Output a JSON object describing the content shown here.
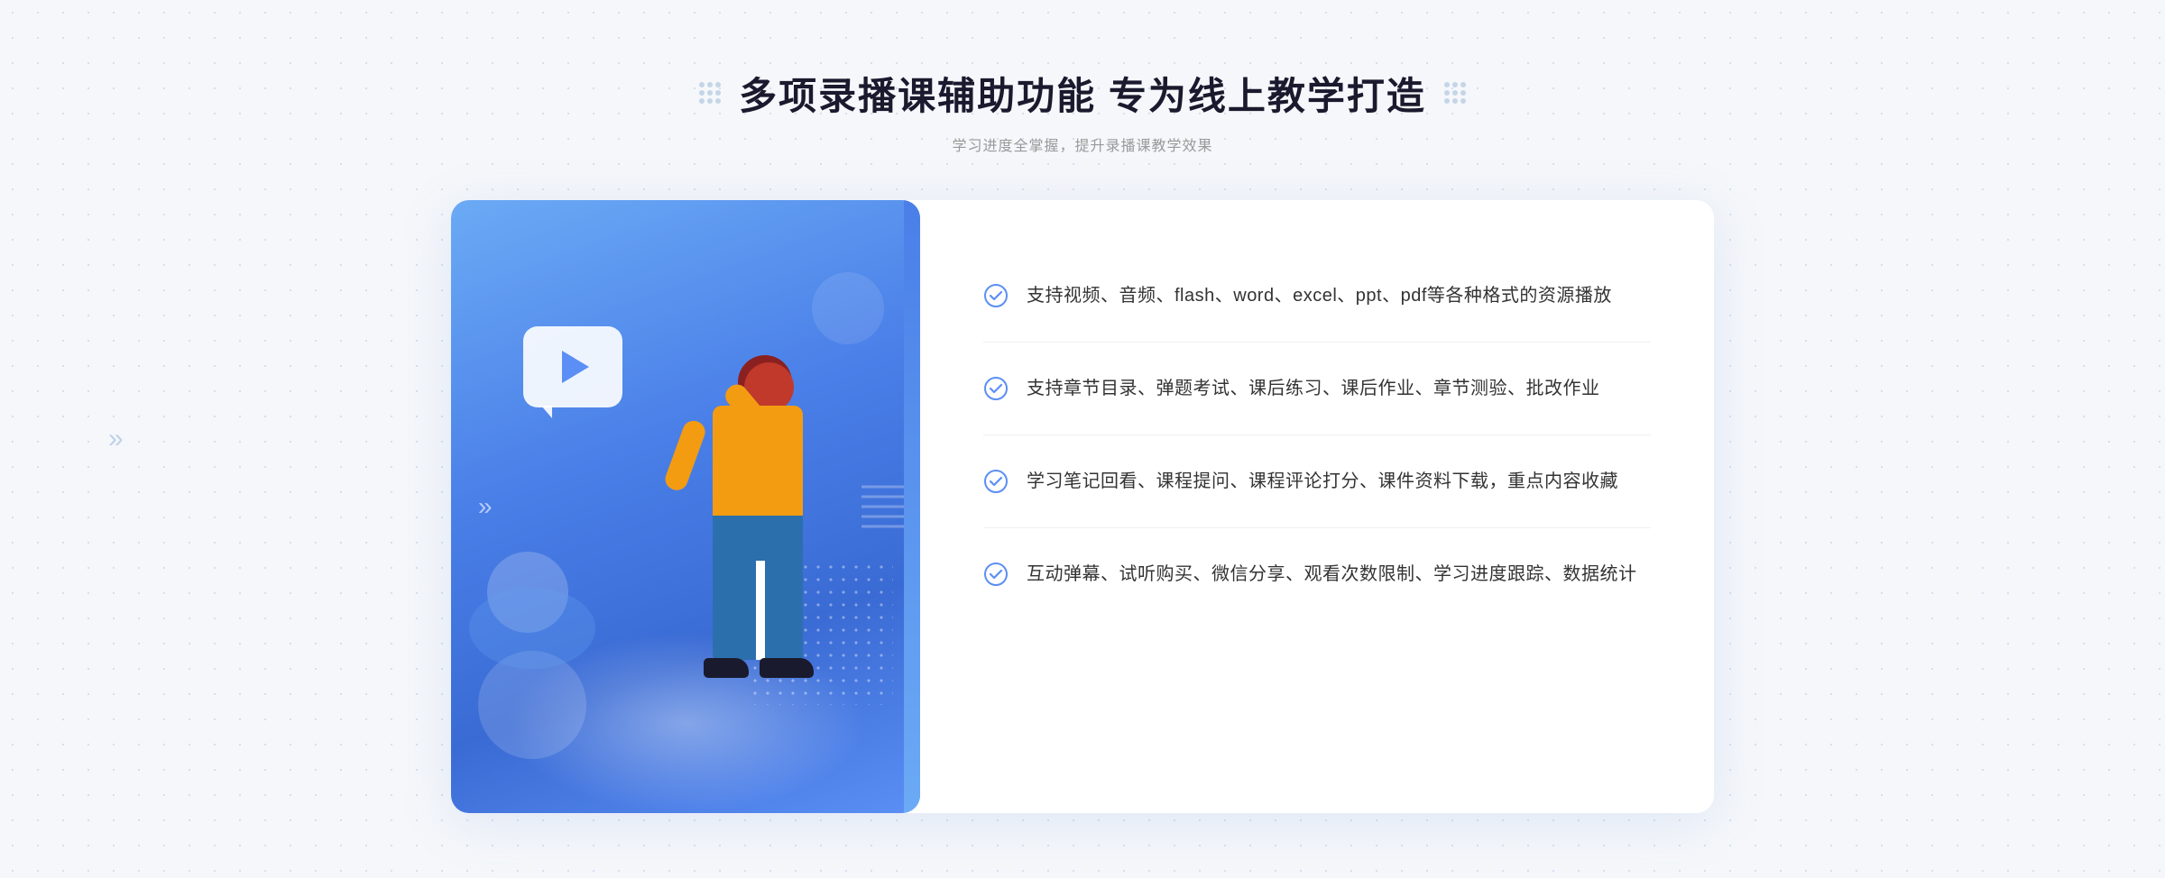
{
  "page": {
    "background": "#f5f7fa",
    "dot_pattern_color": "#c8d8f0"
  },
  "header": {
    "main_title": "多项录播课辅助功能 专为线上教学打造",
    "subtitle": "学习进度全掌握，提升录播课教学效果",
    "left_dots_label": "decorative-dots-left",
    "right_dots_label": "decorative-dots-right"
  },
  "features": [
    {
      "id": 1,
      "text": "支持视频、音频、flash、word、excel、ppt、pdf等各种格式的资源播放",
      "icon": "check-circle-icon"
    },
    {
      "id": 2,
      "text": "支持章节目录、弹题考试、课后练习、课后作业、章节测验、批改作业",
      "icon": "check-circle-icon"
    },
    {
      "id": 3,
      "text": "学习笔记回看、课程提问、课程评论打分、课件资料下载，重点内容收藏",
      "icon": "check-circle-icon"
    },
    {
      "id": 4,
      "text": "互动弹幕、试听购买、微信分享、观看次数限制、学习进度跟踪、数据统计",
      "icon": "check-circle-icon"
    }
  ],
  "left_panel": {
    "play_button_label": "play-video-icon",
    "arrow_label": "navigation-arrows"
  },
  "colors": {
    "blue_gradient_start": "#6baaf5",
    "blue_gradient_end": "#3a6bd4",
    "check_icon_color": "#5b8ff5",
    "title_color": "#1a1a2e",
    "text_color": "#333333",
    "subtitle_color": "#999999"
  }
}
